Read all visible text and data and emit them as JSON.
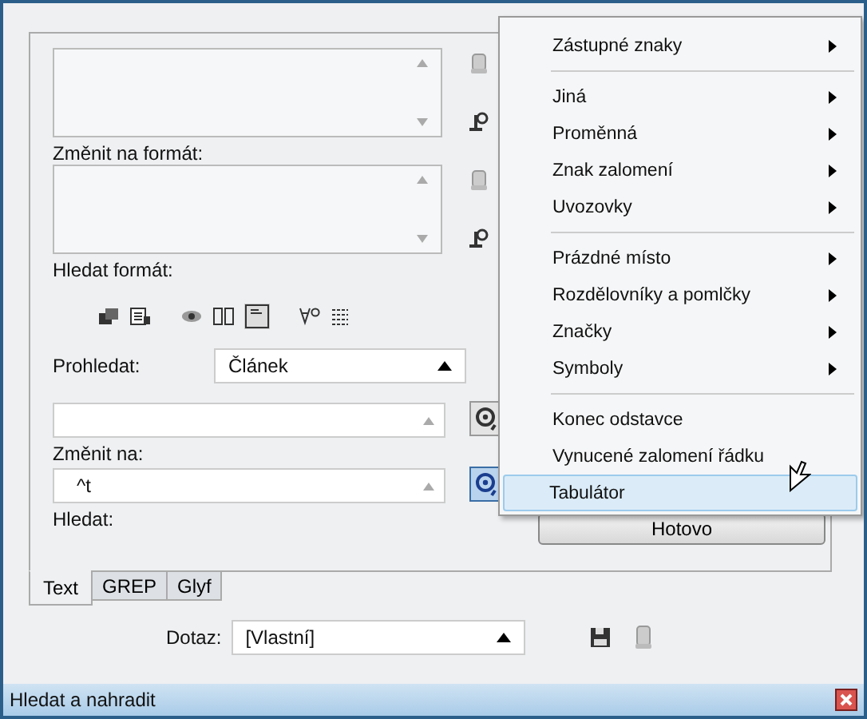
{
  "menu": {
    "groups": [
      [
        {
          "label": "Zástupné znaky",
          "selected": false,
          "submenu": true
        }
      ],
      [
        {
          "label": "Jiná",
          "selected": false,
          "submenu": true
        },
        {
          "label": "Proměnná",
          "selected": false,
          "submenu": true
        },
        {
          "label": "Znak zalomení",
          "selected": false,
          "submenu": true
        },
        {
          "label": "Uvozovky",
          "selected": false,
          "submenu": true
        }
      ],
      [
        {
          "label": "Prázdné místo",
          "selected": false,
          "submenu": true
        },
        {
          "label": "Rozdělovníky a pomlčky",
          "selected": false,
          "submenu": true
        },
        {
          "label": "Značky",
          "selected": false,
          "submenu": true
        },
        {
          "label": "Symboly",
          "selected": false,
          "submenu": true
        }
      ],
      [
        {
          "label": "Konec odstavce",
          "selected": false,
          "submenu": false
        },
        {
          "label": "Vynucené zalomení řádku",
          "selected": false,
          "submenu": false
        },
        {
          "label": "Tabulátor",
          "selected": true,
          "submenu": false
        }
      ]
    ]
  },
  "change_format": {
    "label": "Změnit na formát:"
  },
  "find_format": {
    "label": "Hledat formát:"
  },
  "search_in": {
    "label": "Prohledat:",
    "value": "Článek"
  },
  "change_to": {
    "label": "Změnit na:"
  },
  "find": {
    "label": "Hledat:",
    "value": "^t"
  },
  "buttons": [
    "Hotovo"
  ],
  "tabs": [
    {
      "label": "Text",
      "selected": true
    },
    {
      "label": "GREP",
      "selected": false
    },
    {
      "label": "Glyf",
      "selected": false
    }
  ],
  "query": {
    "label": "Dotaz:",
    "value": "[Vlastní]"
  },
  "window": {
    "title": "Hledat a nahradit"
  }
}
